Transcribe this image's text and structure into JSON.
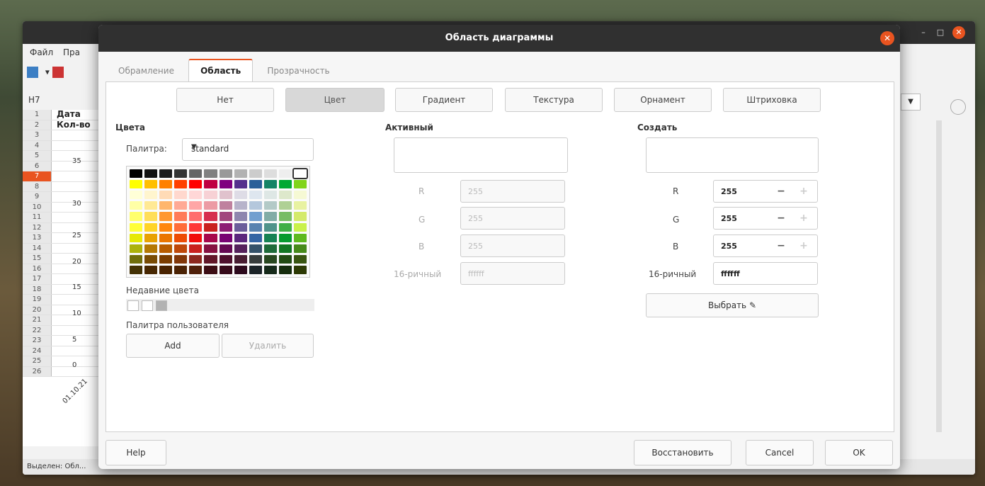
{
  "background_app": {
    "menu": [
      "Файл",
      "Пра"
    ],
    "namebox": "H7",
    "cells": {
      "a1": "Дата",
      "a2": "Кол-во"
    },
    "rows": [
      "1",
      "2",
      "3",
      "4",
      "5",
      "6",
      "7",
      "8",
      "9",
      "10",
      "11",
      "12",
      "13",
      "14",
      "15",
      "16",
      "17",
      "18",
      "19",
      "20",
      "21",
      "22",
      "23",
      "24",
      "25",
      "26"
    ],
    "y_ticks": [
      "35",
      "30",
      "25",
      "20",
      "15",
      "10",
      "5",
      "0"
    ],
    "x_tick": "01.10.21",
    "status": "Выделен: Обл..."
  },
  "dialog": {
    "title": "Область диаграммы",
    "tabs": [
      "Обрамление",
      "Область",
      "Прозрачность"
    ],
    "active_tab": "Область",
    "fill_buttons": [
      "Нет",
      "Цвет",
      "Градиент",
      "Текстура",
      "Орнамент",
      "Штриховка"
    ],
    "active_fill": "Цвет",
    "colors_section": {
      "title": "Цвета",
      "palette_label": "Палитра:",
      "palette_value": "standard",
      "recent_label": "Недавние цвета",
      "user_palette_label": "Палитра пользователя",
      "add_label": "Add",
      "delete_label": "Удалить"
    },
    "active_section": {
      "title": "Активный",
      "r_label": "R",
      "g_label": "G",
      "b_label": "B",
      "hex_label": "16-ричный",
      "r": "255",
      "g": "255",
      "b": "255",
      "hex": "ffffff"
    },
    "create_section": {
      "title": "Создать",
      "r_label": "R",
      "g_label": "G",
      "b_label": "B",
      "hex_label": "16-ричный",
      "r": "255",
      "g": "255",
      "b": "255",
      "hex": "ffffff",
      "pick_label": "Выбрать"
    },
    "footer": {
      "help": "Help",
      "reset": "Восстановить",
      "cancel": "Cancel",
      "ok": "OK"
    }
  },
  "palette_colors": [
    "#000000",
    "#111111",
    "#1c1c1c",
    "#333333",
    "#666666",
    "#808080",
    "#999999",
    "#b2b2b2",
    "#cccccc",
    "#dddddd",
    "#eeeeee",
    "#ffffff",
    "#ffff00",
    "#ffbf00",
    "#ff8000",
    "#ff4000",
    "#ff0000",
    "#bf0041",
    "#800080",
    "#55308d",
    "#2a6099",
    "#158466",
    "#00a933",
    "#81d41a",
    "#ffffd7",
    "#fff5ce",
    "#ffdbb6",
    "#ffd8ce",
    "#ffd7d7",
    "#f7d1d5",
    "#e0c2cd",
    "#dedce6",
    "#dee6ef",
    "#dee7e5",
    "#dde8cb",
    "#f6f9d4",
    "#ffffa6",
    "#ffe994",
    "#ffb66c",
    "#ffaa95",
    "#ffa6a6",
    "#ec9ba4",
    "#bf819e",
    "#b7b3ca",
    "#b4c7dc",
    "#b3cac7",
    "#afd095",
    "#e8f2a1",
    "#ffff6d",
    "#ffde59",
    "#ff972f",
    "#ff7b59",
    "#ff6d6d",
    "#d62e4e",
    "#a1467e",
    "#8e86ae",
    "#729fcf",
    "#81aca6",
    "#77bc65",
    "#d4ea6b",
    "#ffff38",
    "#ffd428",
    "#ff860d",
    "#ff6d39",
    "#ff3838",
    "#c9211e",
    "#8d1d75",
    "#6b5e9b",
    "#5983b0",
    "#50938a",
    "#3faf46",
    "#c9f14b",
    "#e6e905",
    "#e8a202",
    "#ea7500",
    "#ed4c05",
    "#f10d0c",
    "#a7074b",
    "#780373",
    "#5b277d",
    "#3465a4",
    "#168253",
    "#069a2e",
    "#5eb91e",
    "#acb20c",
    "#b47804",
    "#b85c00",
    "#be480a",
    "#c9211e",
    "#861141",
    "#650953",
    "#55215b",
    "#355269",
    "#1e6a39",
    "#127622",
    "#468a1a",
    "#706e0c",
    "#784b04",
    "#7b3d00",
    "#813709",
    "#8d281e",
    "#611729",
    "#4e102d",
    "#481d32",
    "#383d3c",
    "#28471f",
    "#224b12",
    "#395511",
    "#443205",
    "#472702",
    "#492300",
    "#4b2204",
    "#50200a",
    "#3c0d14",
    "#360a1a",
    "#2d0a1d",
    "#1c2428",
    "#152919",
    "#162d0d",
    "#2d3a05"
  ]
}
